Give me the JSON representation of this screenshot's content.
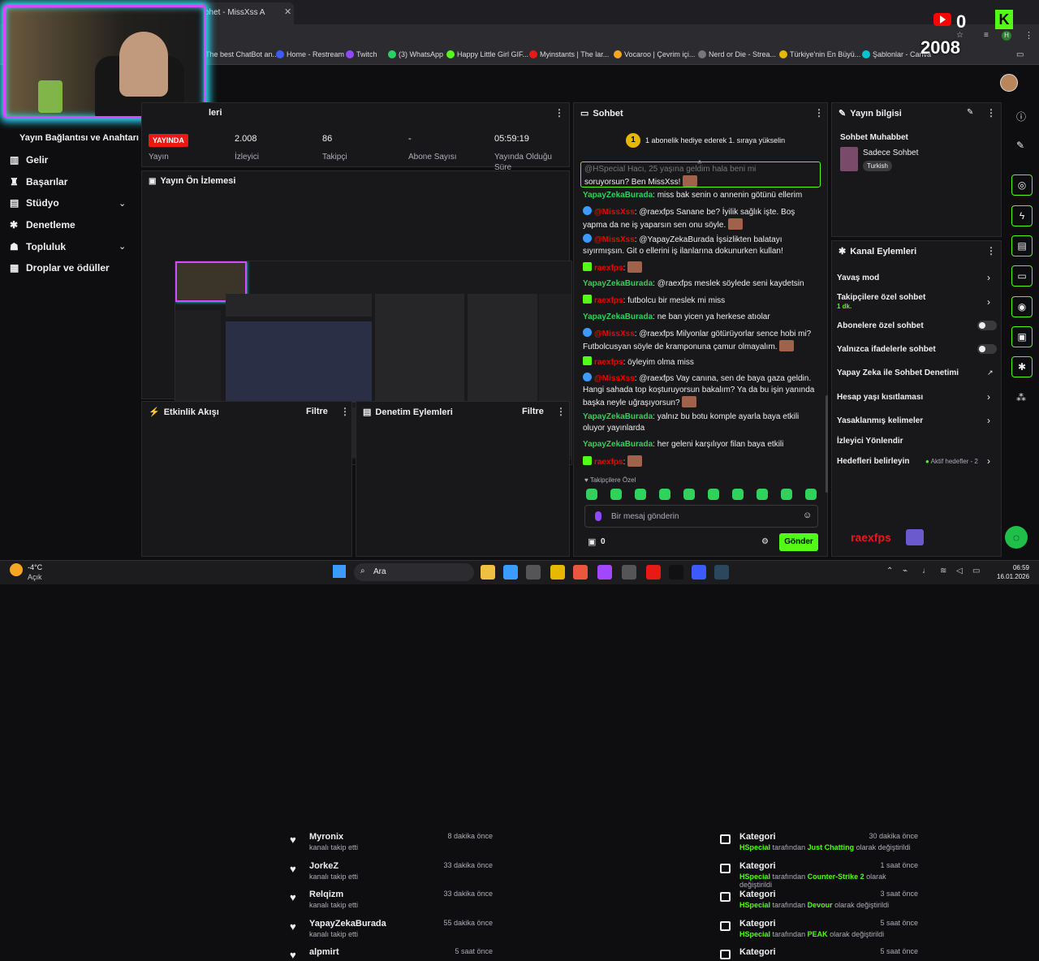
{
  "browser": {
    "tab_title": "bhet - MissXss A",
    "bookmarks": [
      {
        "label": "The best ChatBot an...",
        "color": "#888"
      },
      {
        "label": "Home - Restream",
        "color": "#3b5bff"
      },
      {
        "label": "Twitch",
        "color": "#9146ff"
      },
      {
        "label": "(3) WhatsApp",
        "color": "#25d366"
      },
      {
        "label": "Happy Little Girl GIF...",
        "color": "#53fc18"
      },
      {
        "label": "Myinstants | The lar...",
        "color": "#e91916"
      },
      {
        "label": "Vocaroo | Çevrim içi...",
        "color": "#f5a623"
      },
      {
        "label": "Nerd or Die - Strea...",
        "color": "#777"
      },
      {
        "label": "Türkiye'nin En Büyü...",
        "color": "#e6b800"
      },
      {
        "label": "Şablonlar - Canva",
        "color": "#00c4cc"
      }
    ]
  },
  "overlay": {
    "youtube_count": "0",
    "total_count": "2008",
    "kick_letter": "K"
  },
  "sidebar": {
    "header": "Yayın Bağlantısı ve Anahtarı",
    "items": [
      {
        "label": "Gelir",
        "icon": "chart-icon"
      },
      {
        "label": "Başarılar",
        "icon": "trophy-icon"
      },
      {
        "label": "Stüdyo",
        "icon": "studio-icon"
      },
      {
        "label": "Denetleme",
        "icon": "wrench-icon"
      },
      {
        "label": "Topluluk",
        "icon": "people-icon"
      },
      {
        "label": "Droplar ve ödüller",
        "icon": "gift-icon"
      }
    ]
  },
  "stats_panel": {
    "title": "leri",
    "live_badge": "YAYINDA",
    "live_label": "Yayın",
    "viewers": "2.008",
    "viewers_label": "İzleyici",
    "followers": "86",
    "followers_label": "Takipçi",
    "subs": "-",
    "subs_label": "Abone Sayısı",
    "uptime": "05:59:19",
    "uptime_label": "Yayında Olduğu Süre"
  },
  "preview_panel": {
    "title": "Yayın Ön İzlemesi"
  },
  "activity": {
    "title": "Etkinlik Akışı",
    "filter": "Filtre",
    "items": [
      {
        "name": "Myronix",
        "sub": "kanalı takip etti",
        "time": "8 dakika önce"
      },
      {
        "name": "JorkeZ",
        "sub": "kanalı takip etti",
        "time": "33 dakika önce"
      },
      {
        "name": "Relqizm",
        "sub": "kanalı takip etti",
        "time": "33 dakika önce"
      },
      {
        "name": "YapayZekaBurada",
        "sub": "kanalı takip etti",
        "time": "55 dakika önce"
      },
      {
        "name": "alpmirt",
        "sub": "",
        "time": "5 saat önce"
      }
    ]
  },
  "moderation": {
    "title": "Denetim Eylemleri",
    "filter": "Filtre",
    "items": [
      {
        "title": "Kategori",
        "user": "HSpecial",
        "mid": "tarafından",
        "cat": "Just Chatting",
        "end": "olarak değiştirildi",
        "time": "30 dakika önce"
      },
      {
        "title": "Kategori",
        "user": "HSpecial",
        "mid": "tarafından",
        "cat": "Counter-Strike 2",
        "end": "olarak değiştirildi",
        "time": "1 saat önce"
      },
      {
        "title": "Kategori",
        "user": "HSpecial",
        "mid": "tarafından",
        "cat": "Devour",
        "end": "olarak değiştirildi",
        "time": "3 saat önce"
      },
      {
        "title": "Kategori",
        "user": "HSpecial",
        "mid": "tarafından",
        "cat": "PEAK",
        "end": "olarak değiştirildi",
        "time": "5 saat önce"
      },
      {
        "title": "Kategori",
        "user": "",
        "mid": "",
        "cat": "",
        "end": "",
        "time": "5 saat önce"
      }
    ]
  },
  "chat": {
    "title": "Sohbet",
    "gift_banner": "1 abonelik hediye ederek 1. sıraya yükselin",
    "gift_rank": "1",
    "pinned": "soruyorsun? Ben MissXss!",
    "pinned_top": "@HSpecial Hacı, 25 yaşına geldim hala beni mi",
    "messages": [
      {
        "user": "YapayZekaBurada",
        "color": "green",
        "icon": "",
        "text": ": miss bak senin o annenin götünü ellerim"
      },
      {
        "user": "@MissXss",
        "color": "red",
        "icon": "bot",
        "text": ": @raexfps Sanane be? İyilik sağlık işte. Boş yapma da ne iş yaparsın sen onu söyle."
      },
      {
        "user": "@MissXss",
        "color": "red",
        "icon": "bot",
        "text": ": @YapayZekaBurada İşsizlikten balatayı sıyırmışsın. Git o ellerini iş ilanlarına dokunurken kullan!"
      },
      {
        "user": "raexfps",
        "color": "red",
        "icon": "kick",
        "text": ":"
      },
      {
        "user": "YapayZekaBurada",
        "color": "green",
        "icon": "",
        "text": ": @raexfps meslek söylede seni kaydetsin"
      },
      {
        "user": "raexfps",
        "color": "red",
        "icon": "kick",
        "text": ": futbolcu bir meslek mi miss"
      },
      {
        "user": "YapayZekaBurada",
        "color": "green",
        "icon": "",
        "text": ": ne ban yicen ya herkese atıolar"
      },
      {
        "user": "@MissXss",
        "color": "red",
        "icon": "bot",
        "text": ": @raexfps Milyonlar götürüyorlar sence hobi mi? Futbolcusyan söyle de kramponuna çamur olmayalım."
      },
      {
        "user": "raexfps",
        "color": "red",
        "icon": "kick",
        "text": ": öyleyim olma miss"
      },
      {
        "user": "@MissXss",
        "color": "red",
        "icon": "bot",
        "text": ": @raexfps Vay canına, sen de baya gaza geldin. Hangi sahada top koşturuyorsun bakalım? Ya da bu işin yanında başka neyle uğraşıyorsun?"
      },
      {
        "user": "YapayZekaBurada",
        "color": "green",
        "icon": "",
        "text": ": yalnız bu botu komple ayarla baya etkili oluyor yayınlarda"
      },
      {
        "user": "YapayZekaBurada",
        "color": "green",
        "icon": "",
        "text": ": her geleni karşılıyor filan baya etkili"
      },
      {
        "user": "raexfps",
        "color": "red",
        "icon": "kick",
        "text": ":"
      }
    ],
    "mode_label": "Takipçilere Özel",
    "input_placeholder": "Bir mesaj gönderin",
    "points": "0",
    "send": "Gönder"
  },
  "stream_info": {
    "title": "Yayın bilgisi",
    "category": "Sohbet Muhabbet",
    "game": "Sadece Sohbet",
    "tag": "Turkish"
  },
  "channel_actions": {
    "title": "Kanal Eylemleri",
    "slow": "Yavaş mod",
    "followers_only": "Takipçilere özel sohbet",
    "followers_only_sub": "1 dk.",
    "subs_only": "Abonelere özel sohbet",
    "emotes_only": "Yalnızca ifadelerle sohbet",
    "ai_mod": "Yapay Zeka ile Sohbet Denetimi",
    "age": "Hesap yaşı kısıtlaması",
    "banned_words": "Yasaklanmış kelimeler",
    "raid": "İzleyici Yönlendir",
    "goals": "Hedefleri belirleyin",
    "goals_status": "Aktif hedefler - 2",
    "overlay_name": "raexfps"
  },
  "taskbar": {
    "weather_temp": "-4°C",
    "weather_desc": "Açık",
    "search": "Ara",
    "time": "06:59",
    "date": "16.01.2026"
  }
}
